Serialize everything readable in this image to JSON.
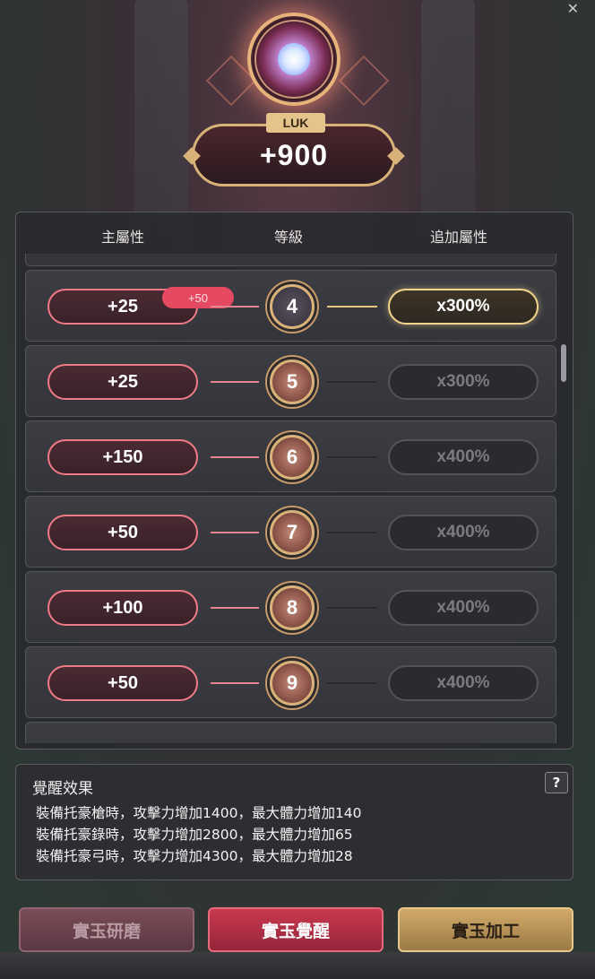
{
  "header": {
    "stat_label": "LUK",
    "stat_value": "+900",
    "close_icon": "close-icon"
  },
  "table": {
    "columns": [
      "主屬性",
      "等級",
      "追加屬性"
    ],
    "rows": [
      {
        "main": "+25",
        "level": "4",
        "bonus": "x300%",
        "active": true,
        "tag": "+50"
      },
      {
        "main": "+25",
        "level": "5",
        "bonus": "x300%",
        "active": false
      },
      {
        "main": "+150",
        "level": "6",
        "bonus": "x400%",
        "active": false
      },
      {
        "main": "+50",
        "level": "7",
        "bonus": "x400%",
        "active": false
      },
      {
        "main": "+100",
        "level": "8",
        "bonus": "x400%",
        "active": false
      },
      {
        "main": "+50",
        "level": "9",
        "bonus": "x400%",
        "active": false
      }
    ]
  },
  "effects": {
    "title": "覺醒效果",
    "help": "?",
    "lines": [
      "裝備托豪槍時，攻擊力增加1400，最大體力增加140",
      "裝備托豪錄時，攻擊力增加2800，最大體力增加65",
      "裝備托豪弓時，攻擊力增加4300，最大體力增加28"
    ]
  },
  "buttons": {
    "polish": "實玉研磨",
    "awaken": "實玉覺醒",
    "process": "實玉加工"
  },
  "colors": {
    "accent_red": "#e64a63",
    "gold": "#d9b27a",
    "active_bonus": "#f3d48d"
  }
}
